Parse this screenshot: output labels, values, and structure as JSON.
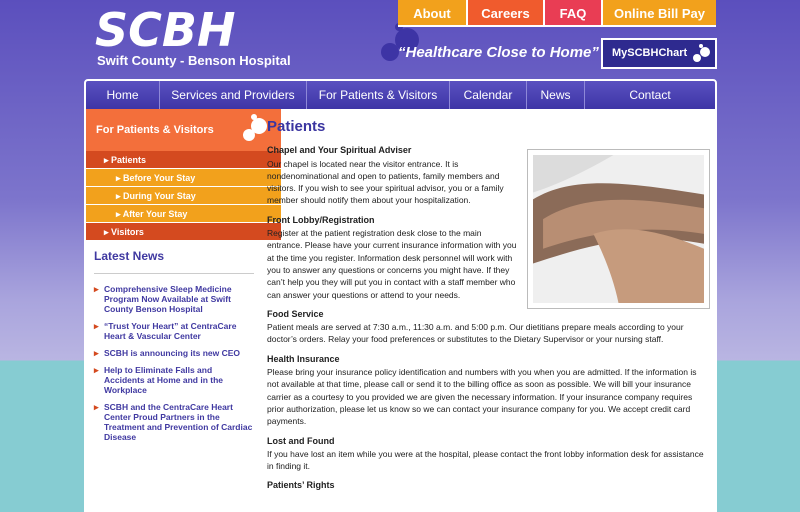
{
  "brand": {
    "logo": "SCBH",
    "hospital_name": "Swift County - Benson Hospital",
    "tagline": "“Healthcare Close to Home”"
  },
  "topnav": [
    {
      "label": "About",
      "color": "#f2a11c"
    },
    {
      "label": "Careers",
      "color": "#f05b2d"
    },
    {
      "label": "FAQ",
      "color": "#e93d54"
    },
    {
      "label": "Online Bill Pay",
      "color": "#f2a11c"
    }
  ],
  "mychart": {
    "label": "MySCBHChart"
  },
  "mainnav": [
    "Home",
    "Services and Providers",
    "For Patients & Visitors",
    "Calendar",
    "News",
    "Contact"
  ],
  "sidebar": {
    "heading": "For Patients & Visitors",
    "items": [
      {
        "label": "Patients"
      },
      {
        "label": "Before Your Stay"
      },
      {
        "label": "During Your Stay"
      },
      {
        "label": "After Your Stay"
      },
      {
        "label": "Visitors"
      }
    ]
  },
  "news": {
    "heading": "Latest News",
    "items": [
      "Comprehensive Sleep Medicine Program Now Available at Swift County Benson Hospital",
      "“Trust Your Heart” at CentraCare Heart & Vascular Center",
      "SCBH is announcing its new CEO",
      "Help to Eliminate Falls and Accidents at Home and in the Workplace",
      "SCBH and the CentraCare Heart Center Proud Partners in the Treatment and Prevention of Cardiac Disease"
    ]
  },
  "page": {
    "title": "Patients",
    "sections": [
      {
        "heading": "Chapel and Your Spiritual Adviser",
        "text": "Our chapel is located near the visitor entrance. It is nondenominational and open to patients, family members and visitors. If you wish to see your spiritual advisor, you or a family member should notify them about your hospitalization."
      },
      {
        "heading": "Front Lobby/Registration",
        "text": "Register at the patient registration desk close to the main entrance. Please have your current insurance information with you at the time you register.  Information desk personnel will work with you to answer any questions or concerns you might have. If they can’t help you they will put you in contact with a staff member who can answer your questions or attend to your needs."
      },
      {
        "heading": "Food Service",
        "text": "Patient meals are served at 7:30 a.m., 11:30 a.m. and 5:00 p.m. Our dietitians prepare meals according to your doctor’s orders. Relay your food preferences or substitutes to the Dietary Supervisor or your nursing staff."
      },
      {
        "heading": "Health Insurance",
        "text": "Please bring your insurance policy identification and numbers with you when you are admitted. If the information is not available at that time, please call or send it to the billing office as soon as possible. We will bill your insurance carrier as a courtesy to you provided we are given the necessary information. If your insurance company requires prior authorization, please let us know so we can contact your insurance company for you.  We accept credit card payments."
      },
      {
        "heading": "Lost and Found",
        "text": "If you have lost an item while you were at the hospital, please contact the front lobby information desk for assistance in finding it."
      },
      {
        "heading": "Patients’ Rights",
        "text": ""
      }
    ]
  }
}
